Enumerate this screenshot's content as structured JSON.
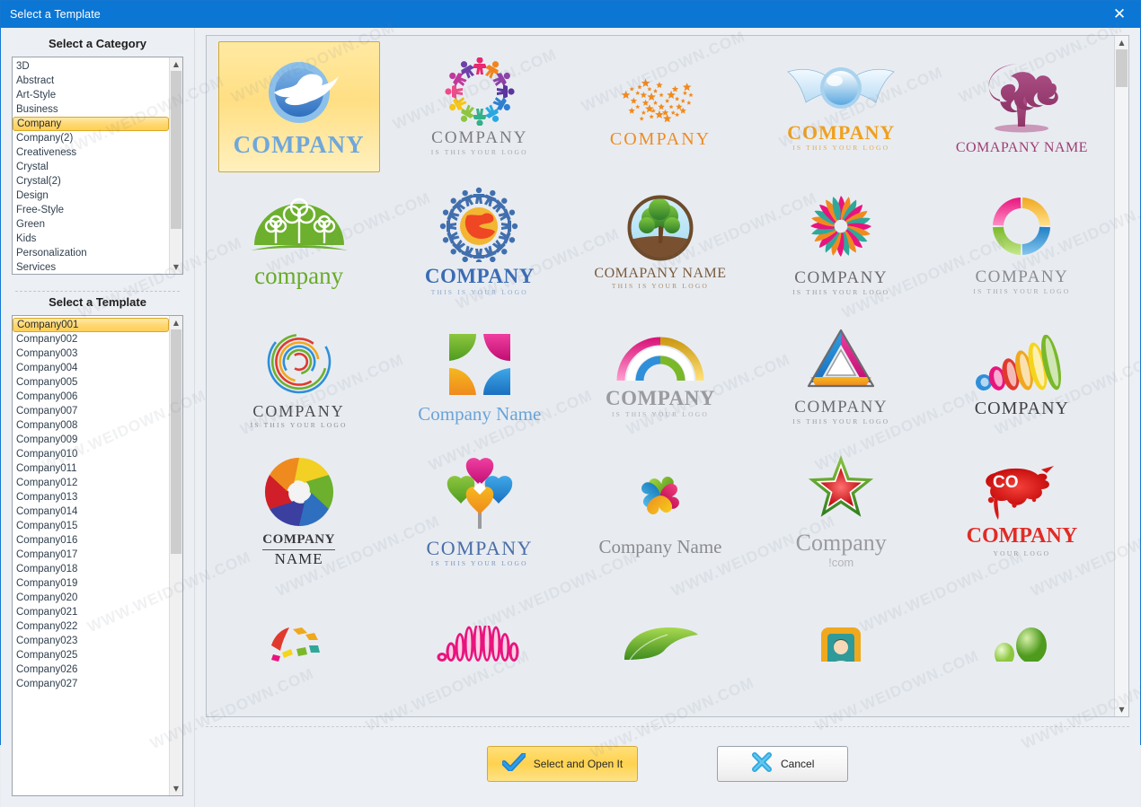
{
  "window": {
    "title": "Select a Template",
    "close_icon": "close-icon"
  },
  "category_panel": {
    "heading": "Select a Category",
    "selected": "Company",
    "items": [
      "3D",
      "Abstract",
      "Art-Style",
      "Business",
      "Company",
      "Company(2)",
      "Creativeness",
      "Crystal",
      "Crystal(2)",
      "Design",
      "Free-Style",
      "Green",
      "Kids",
      "Personalization",
      "Services"
    ]
  },
  "template_panel": {
    "heading": "Select a Template",
    "selected": "Company001",
    "items": [
      "Company001",
      "Company002",
      "Company003",
      "Company004",
      "Company005",
      "Company006",
      "Company007",
      "Company008",
      "Company009",
      "Company010",
      "Company011",
      "Company012",
      "Company013",
      "Company014",
      "Company015",
      "Company016",
      "Company017",
      "Company018",
      "Company019",
      "Company020",
      "Company021",
      "Company022",
      "Company023",
      "Company025",
      "Company026",
      "Company027"
    ]
  },
  "gallery": {
    "selected_index": 0,
    "thumbs": [
      {
        "art": "dove-circle",
        "main": "COMPANY",
        "sub": "",
        "main_color": "#6fa7dc",
        "sub_color": "#8aa9c4",
        "main_size": "27px",
        "main_weight": "bold",
        "main_spacing": "1px"
      },
      {
        "art": "people-ring",
        "main": "COMPANY",
        "sub": "IS THIS YOUR LOGO",
        "main_color": "#7c7c80",
        "sub_color": "#a6a6aa",
        "main_size": "19px",
        "main_weight": "normal",
        "main_spacing": "2px"
      },
      {
        "art": "star-swarm",
        "main": "COMPANY",
        "sub": "",
        "main_color": "#ef8b21",
        "sub_color": "#efab6a",
        "main_size": "20px",
        "main_weight": "normal",
        "main_spacing": "2px"
      },
      {
        "art": "winged-orb",
        "main": "COMPANY",
        "sub": "IS THIS YOUR LOGO",
        "main_color": "#f0a01e",
        "sub_color": "#e8a949",
        "main_size": "22px",
        "main_weight": "bold",
        "main_spacing": "1px"
      },
      {
        "art": "swirl-tree",
        "main": "COMAPANY NAME",
        "sub": "",
        "main_color": "#9e3d74",
        "sub_color": "#b06a93",
        "main_size": "16px",
        "main_weight": "normal",
        "main_spacing": "0.5px"
      },
      {
        "art": "green-dome",
        "main": "company",
        "sub": "",
        "main_color": "#69ab28",
        "sub_color": "#8cc65a",
        "main_size": "27px",
        "main_weight": "normal",
        "main_spacing": "0px"
      },
      {
        "art": "globe-people",
        "main": "COMPANY",
        "sub": "THIS IS YOUR LOGO",
        "main_color": "#3b6cb5",
        "sub_color": "#8fa7cc",
        "main_size": "23px",
        "main_weight": "bold",
        "main_spacing": "0.5px"
      },
      {
        "art": "circle-tree",
        "main": "COMAPANY NAME",
        "sub": "THIS IS YOUR LOGO",
        "main_color": "#7b5a3c",
        "sub_color": "#a78c6d",
        "main_size": "16px",
        "main_weight": "normal",
        "main_spacing": "0.5px"
      },
      {
        "art": "sun-burst",
        "main": "COMPANY",
        "sub": "IS THIS YOUR LOGO",
        "main_color": "#6b6b70",
        "sub_color": "#9a9a9e",
        "main_size": "19px",
        "main_weight": "normal",
        "main_spacing": "1.5px"
      },
      {
        "art": "quad-ring",
        "main": "COMPANY",
        "sub": "IS THIS YOUR LOGO",
        "main_color": "#8a8a8f",
        "sub_color": "#a8a8ac",
        "main_size": "19px",
        "main_weight": "normal",
        "main_spacing": "1.5px"
      },
      {
        "art": "spiral-ring",
        "main": "COMPANY",
        "sub": "IS THIS YOUR LOGO",
        "main_color": "#4b4b50",
        "sub_color": "#8d8d92",
        "main_size": "18px",
        "main_weight": "normal",
        "main_spacing": "2px"
      },
      {
        "art": "petal-square",
        "main": "Company Name",
        "sub": "",
        "main_color": "#6ba3d6",
        "sub_color": "#8fb8dd",
        "main_size": "21px",
        "main_weight": "normal",
        "main_spacing": "0px"
      },
      {
        "art": "rainbow-arch",
        "main": "COMPANY",
        "sub": "IS THIS YOUR LOGO",
        "main_color": "#9a9a9f",
        "sub_color": "#aeaeb2",
        "main_size": "23px",
        "main_weight": "bold",
        "main_spacing": "0.5px"
      },
      {
        "art": "tri-ribbon",
        "main": "COMPANY",
        "sub": "IS THIS YOUR LOGO",
        "main_color": "#6b6b70",
        "sub_color": "#9b9b9f",
        "main_size": "19px",
        "main_weight": "normal",
        "main_spacing": "1.5px"
      },
      {
        "art": "rainbow-wave",
        "main": "COMPANY",
        "sub": "",
        "main_color": "#3f3f44",
        "sub_color": "#87878c",
        "main_size": "20px",
        "main_weight": "normal",
        "main_spacing": "1px"
      },
      {
        "art": "aperture",
        "main": "COMPANY",
        "sub": "NAME",
        "main_color": "#3a3a3f",
        "sub_color": "#2e2e33",
        "main_size": "15px",
        "main_weight": "bold",
        "main_spacing": "0.5px"
      },
      {
        "art": "heart-diamond",
        "main": "COMPANY",
        "sub": "IS THIS YOUR LOGO",
        "main_color": "#4a6ea8",
        "sub_color": "#7d96bd",
        "main_size": "22px",
        "main_weight": "normal",
        "main_spacing": "1.5px"
      },
      {
        "art": "heart-clover",
        "main": "Company Name",
        "sub": "",
        "main_color": "#8a8a8f",
        "sub_color": "#a4a4a9",
        "main_size": "21px",
        "main_weight": "normal",
        "main_spacing": "0px"
      },
      {
        "art": "star-green",
        "main": "Company",
        "sub": "!com",
        "main_color": "#9b9ba0",
        "sub_color": "#b4b4b9",
        "main_size": "26px",
        "main_weight": "normal",
        "main_spacing": "0px"
      },
      {
        "art": "red-splatter",
        "main": "COMPANY",
        "sub": "YOUR LOGO",
        "main_color": "#e12b26",
        "sub_color": "#9b9b9f",
        "main_size": "24px",
        "main_weight": "bold",
        "main_spacing": "0px"
      },
      {
        "art": "burst-partial",
        "main": "",
        "sub": "",
        "main_color": "#888",
        "sub_color": "#aaa",
        "main_size": "12px",
        "main_weight": "normal",
        "main_spacing": "0px"
      },
      {
        "art": "pink-wave",
        "main": "",
        "sub": "",
        "main_color": "#888",
        "sub_color": "#aaa",
        "main_size": "12px",
        "main_weight": "normal",
        "main_spacing": "0px"
      },
      {
        "art": "green-leaf",
        "main": "",
        "sub": "",
        "main_color": "#888",
        "sub_color": "#aaa",
        "main_size": "12px",
        "main_weight": "normal",
        "main_spacing": "0px"
      },
      {
        "art": "photo-frame",
        "main": "",
        "sub": "",
        "main_color": "#888",
        "sub_color": "#aaa",
        "main_size": "12px",
        "main_weight": "normal",
        "main_spacing": "0px"
      },
      {
        "art": "green-spheres",
        "main": "",
        "sub": "",
        "main_color": "#888",
        "sub_color": "#aaa",
        "main_size": "12px",
        "main_weight": "normal",
        "main_spacing": "0px"
      }
    ]
  },
  "footer": {
    "primary_label": "Select and Open It",
    "primary_icon": "checkmark-icon",
    "secondary_label": "Cancel",
    "secondary_icon": "cross-icon"
  },
  "watermark": {
    "text": "WWW.WEIDOWN.COM"
  },
  "colors": {
    "titlebar": "#0b76d4",
    "accent_selection": "#ffd24f",
    "panel_bg": "#eceff3",
    "gallery_bg": "#e8ecf1"
  }
}
